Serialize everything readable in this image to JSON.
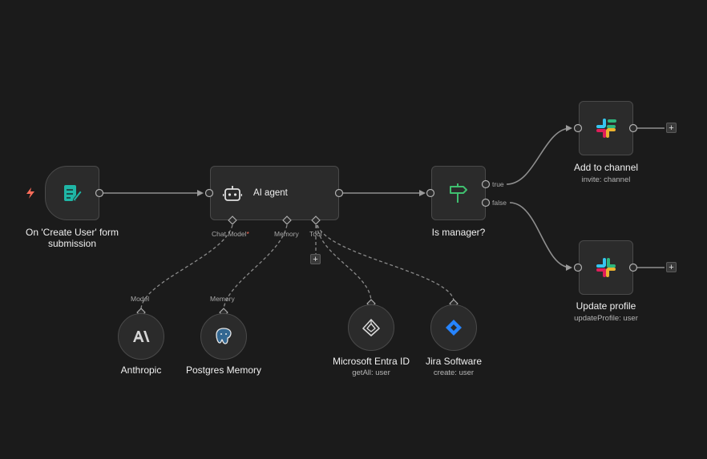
{
  "colors": {
    "background": "#1b1b1b",
    "node_bg": "#2b2b2b",
    "node_border": "#4a4a4a",
    "edge": "#8f8f8f",
    "trigger_bolt": "#ff6d5a",
    "form_icon": "#1fb6a6",
    "if_icon": "#3fbf6f",
    "jira": "#2684ff"
  },
  "trigger": {
    "label_line1": "On 'Create User' form",
    "label_line2": "submission",
    "icon": "form-icon",
    "bolt_icon": "lightning-bolt-icon"
  },
  "agent": {
    "title": "AI agent",
    "icon": "robot-icon",
    "ports": {
      "chat_model": "Chat Model",
      "chat_model_required": "*",
      "memory": "Memory",
      "tool": "Tool"
    }
  },
  "condition": {
    "label": "Is manager?",
    "icon": "signpost-icon",
    "branch_true": "true",
    "branch_false": "false"
  },
  "add_channel": {
    "label": "Add to channel",
    "sublabel": "invite: channel",
    "icon": "slack-icon"
  },
  "update_profile": {
    "label": "Update profile",
    "sublabel": "updateProfile: user",
    "icon": "slack-icon"
  },
  "model_node": {
    "port_label": "Model",
    "label": "Anthropic",
    "icon": "anthropic-icon"
  },
  "memory_node": {
    "port_label": "Memory",
    "label": "Postgres Memory",
    "icon": "postgres-icon"
  },
  "entra_node": {
    "label": "Microsoft Entra ID",
    "sublabel": "getAll: user",
    "icon": "entra-icon"
  },
  "jira_node": {
    "label": "Jira Software",
    "sublabel": "create: user",
    "icon": "jira-icon"
  },
  "plus": "+"
}
